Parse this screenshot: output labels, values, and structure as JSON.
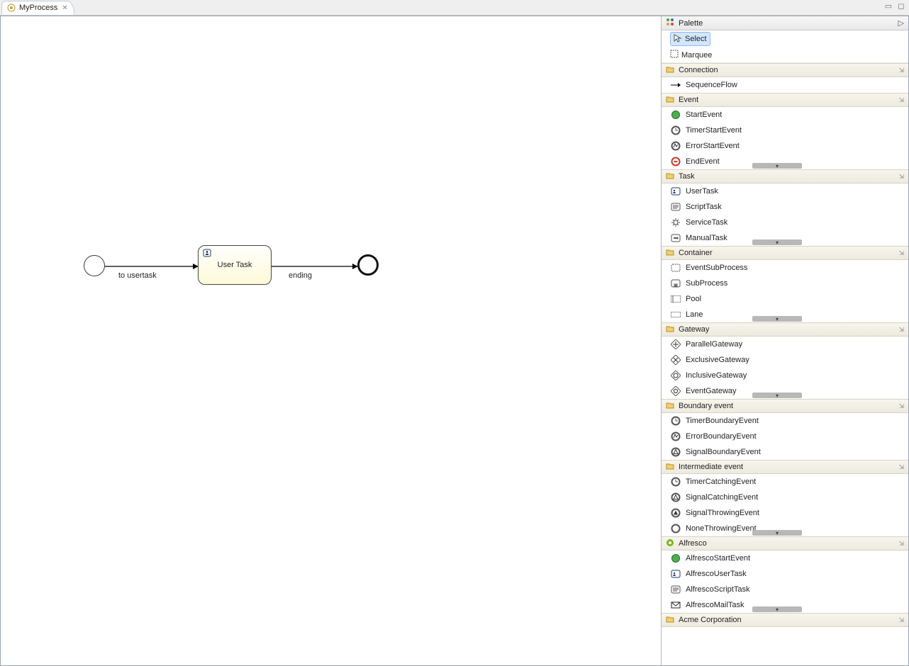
{
  "tab": {
    "title": "MyProcess"
  },
  "canvas": {
    "nodes": {
      "start": {
        "type": "startEvent"
      },
      "usertask": {
        "label": "User Task",
        "type": "userTask"
      },
      "end": {
        "type": "endEvent"
      }
    },
    "edges": [
      {
        "label": "to usertask"
      },
      {
        "label": "ending"
      }
    ]
  },
  "palette": {
    "title": "Palette",
    "tools": [
      {
        "label": "Select",
        "icon": "cursor-icon",
        "selected": true
      },
      {
        "label": "Marquee",
        "icon": "marquee-icon",
        "selected": false
      }
    ],
    "categories": [
      {
        "name": "Connection",
        "icon": "folder-icon",
        "items": [
          {
            "label": "SequenceFlow",
            "icon": "arrow-right-icon"
          }
        ]
      },
      {
        "name": "Event",
        "icon": "folder-icon",
        "hasMore": true,
        "items": [
          {
            "label": "StartEvent",
            "icon": "start-event-icon"
          },
          {
            "label": "TimerStartEvent",
            "icon": "timer-event-icon"
          },
          {
            "label": "ErrorStartEvent",
            "icon": "error-event-icon"
          },
          {
            "label": "EndEvent",
            "icon": "end-event-icon"
          }
        ]
      },
      {
        "name": "Task",
        "icon": "folder-icon",
        "hasMore": true,
        "items": [
          {
            "label": "UserTask",
            "icon": "user-task-icon"
          },
          {
            "label": "ScriptTask",
            "icon": "script-task-icon"
          },
          {
            "label": "ServiceTask",
            "icon": "gear-task-icon"
          },
          {
            "label": "ManualTask",
            "icon": "manual-task-icon"
          }
        ]
      },
      {
        "name": "Container",
        "icon": "folder-icon",
        "hasMore": true,
        "items": [
          {
            "label": "EventSubProcess",
            "icon": "event-subprocess-icon"
          },
          {
            "label": "SubProcess",
            "icon": "subprocess-icon"
          },
          {
            "label": "Pool",
            "icon": "pool-icon"
          },
          {
            "label": "Lane",
            "icon": "lane-icon"
          }
        ]
      },
      {
        "name": "Gateway",
        "icon": "folder-icon",
        "hasMore": true,
        "items": [
          {
            "label": "ParallelGateway",
            "icon": "parallel-gateway-icon"
          },
          {
            "label": "ExclusiveGateway",
            "icon": "exclusive-gateway-icon"
          },
          {
            "label": "InclusiveGateway",
            "icon": "inclusive-gateway-icon"
          },
          {
            "label": "EventGateway",
            "icon": "event-gateway-icon"
          }
        ]
      },
      {
        "name": "Boundary event",
        "icon": "folder-icon",
        "items": [
          {
            "label": "TimerBoundaryEvent",
            "icon": "timer-event-icon"
          },
          {
            "label": "ErrorBoundaryEvent",
            "icon": "error-event-icon"
          },
          {
            "label": "SignalBoundaryEvent",
            "icon": "signal-event-icon"
          }
        ]
      },
      {
        "name": "Intermediate event",
        "icon": "folder-icon",
        "hasMore": true,
        "items": [
          {
            "label": "TimerCatchingEvent",
            "icon": "timer-event-icon"
          },
          {
            "label": "SignalCatchingEvent",
            "icon": "signal-catch-icon"
          },
          {
            "label": "SignalThrowingEvent",
            "icon": "signal-throw-icon"
          },
          {
            "label": "NoneThrowingEvent",
            "icon": "none-throw-icon"
          }
        ]
      },
      {
        "name": "Alfresco",
        "icon": "alfresco-icon",
        "hasMore": true,
        "items": [
          {
            "label": "AlfrescoStartEvent",
            "icon": "start-event-icon"
          },
          {
            "label": "AlfrescoUserTask",
            "icon": "user-task-icon"
          },
          {
            "label": "AlfrescoScriptTask",
            "icon": "script-task-icon"
          },
          {
            "label": "AlfrescoMailTask",
            "icon": "mail-task-icon"
          }
        ]
      },
      {
        "name": "Acme Corporation",
        "icon": "folder-icon",
        "items": []
      }
    ]
  }
}
